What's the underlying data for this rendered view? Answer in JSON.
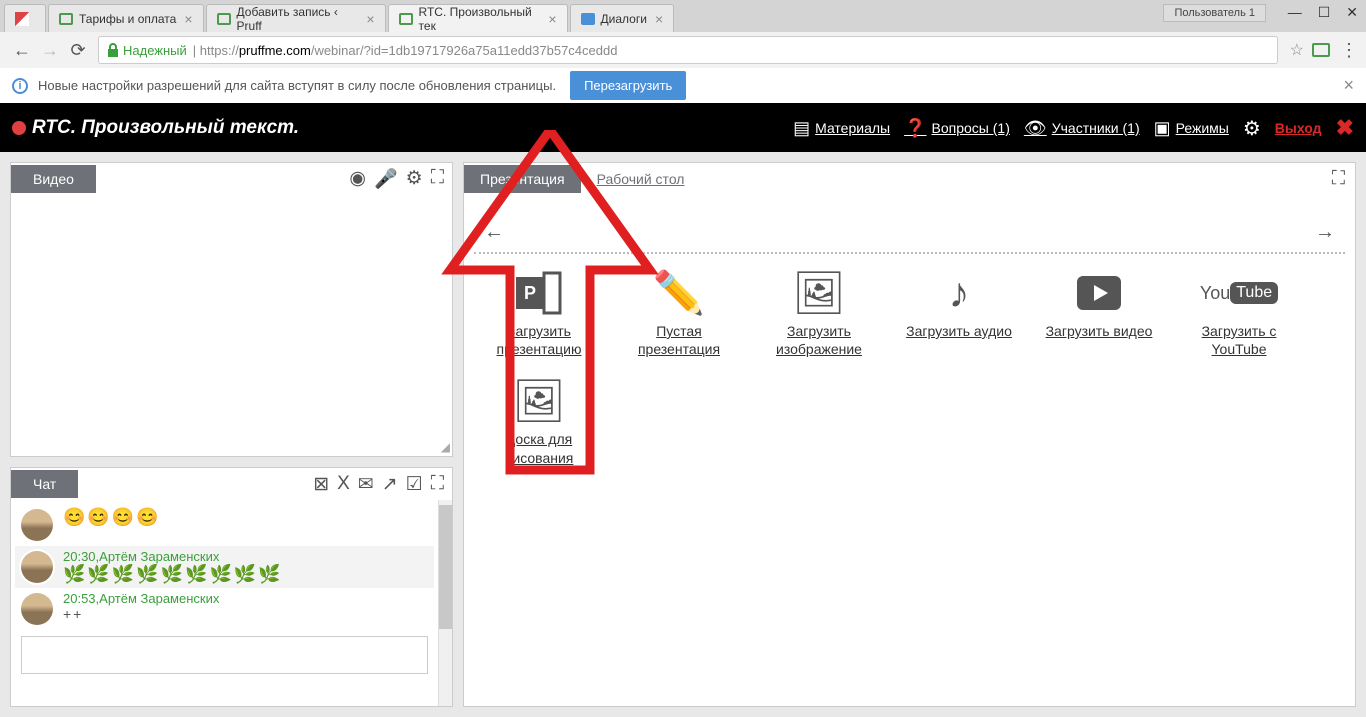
{
  "browser": {
    "user_badge": "Пользователь 1",
    "tabs": [
      {
        "label": ""
      },
      {
        "label": "Тарифы и оплата"
      },
      {
        "label": "Добавить запись ‹ Pruff"
      },
      {
        "label": "RTC. Произвольный тек"
      },
      {
        "label": "Диалоги"
      }
    ],
    "secure_label": "Надежный",
    "url_prefix": "https://",
    "url_host": "pruffme.com",
    "url_path": "/webinar/?id=1db19717926a75a11edd37b57c4ceddd"
  },
  "infobar": {
    "text": "Новые настройки разрешений для сайта вступят в силу после обновления страницы.",
    "reload": "Перезагрузить"
  },
  "header": {
    "title": "RTC. Произвольный текст.",
    "materials": "Материалы",
    "questions": "Вопросы (1)",
    "participants": "Участники (1)",
    "modes": "Режимы",
    "exit": "Выход"
  },
  "video": {
    "tab": "Видео"
  },
  "chat": {
    "tab": "Чат",
    "messages": [
      {
        "time": "",
        "author": "",
        "content": "😊😊😊😊",
        "cls": ""
      },
      {
        "time": "20:30,",
        "author": "Артём Зараменских",
        "content": "🌿🌿🌿🌿🌿🌿🌿🌿🌿",
        "cls": "leaves"
      },
      {
        "time": "20:53,",
        "author": "Артём Зараменских",
        "content": "++",
        "cls": "plus"
      }
    ]
  },
  "presentation": {
    "tab_active": "Презентация",
    "tab_desktop": "Рабочий стол",
    "items": [
      {
        "label": "Загрузить презентацию",
        "icon": "ppt"
      },
      {
        "label": "Пустая презентация",
        "icon": "pencil"
      },
      {
        "label": "Загрузить изображение",
        "icon": "image"
      },
      {
        "label": "Загрузить аудио",
        "icon": "audio"
      },
      {
        "label": "Загрузить видео",
        "icon": "video"
      },
      {
        "label": "Загрузить с YouTube",
        "icon": "youtube"
      },
      {
        "label": "Доска для рисования",
        "icon": "board"
      }
    ]
  }
}
